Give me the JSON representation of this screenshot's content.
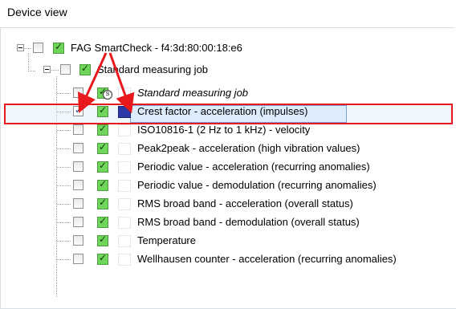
{
  "panel": {
    "title": "Device view"
  },
  "device": {
    "label": "FAG SmartCheck - f4:3d:80:00:18:e6"
  },
  "job": {
    "label": "Standard measuring job"
  },
  "items": [
    {
      "label": "Standard measuring job",
      "italic": true,
      "selected": false,
      "color": ""
    },
    {
      "label": "Crest factor - acceleration (impulses)",
      "italic": false,
      "selected": true,
      "color": "#2b38a6"
    },
    {
      "label": "ISO10816-1 (2 Hz to 1 kHz) - velocity",
      "italic": false,
      "selected": false,
      "color": ""
    },
    {
      "label": "Peak2peak - acceleration (high vibration values)",
      "italic": false,
      "selected": false,
      "color": ""
    },
    {
      "label": "Periodic value - acceleration (recurring anomalies)",
      "italic": false,
      "selected": false,
      "color": ""
    },
    {
      "label": "Periodic value - demodulation (recurring anomalies)",
      "italic": false,
      "selected": false,
      "color": ""
    },
    {
      "label": "RMS broad band - acceleration (overall status)",
      "italic": false,
      "selected": false,
      "color": ""
    },
    {
      "label": "RMS broad band - demodulation (overall status)",
      "italic": false,
      "selected": false,
      "color": ""
    },
    {
      "label": "Temperature",
      "italic": false,
      "selected": false,
      "color": ""
    },
    {
      "label": "Wellhausen counter - acceleration (recurring anomalies)",
      "italic": false,
      "selected": false,
      "color": ""
    }
  ],
  "annotation": {
    "color": "#e8181c"
  }
}
